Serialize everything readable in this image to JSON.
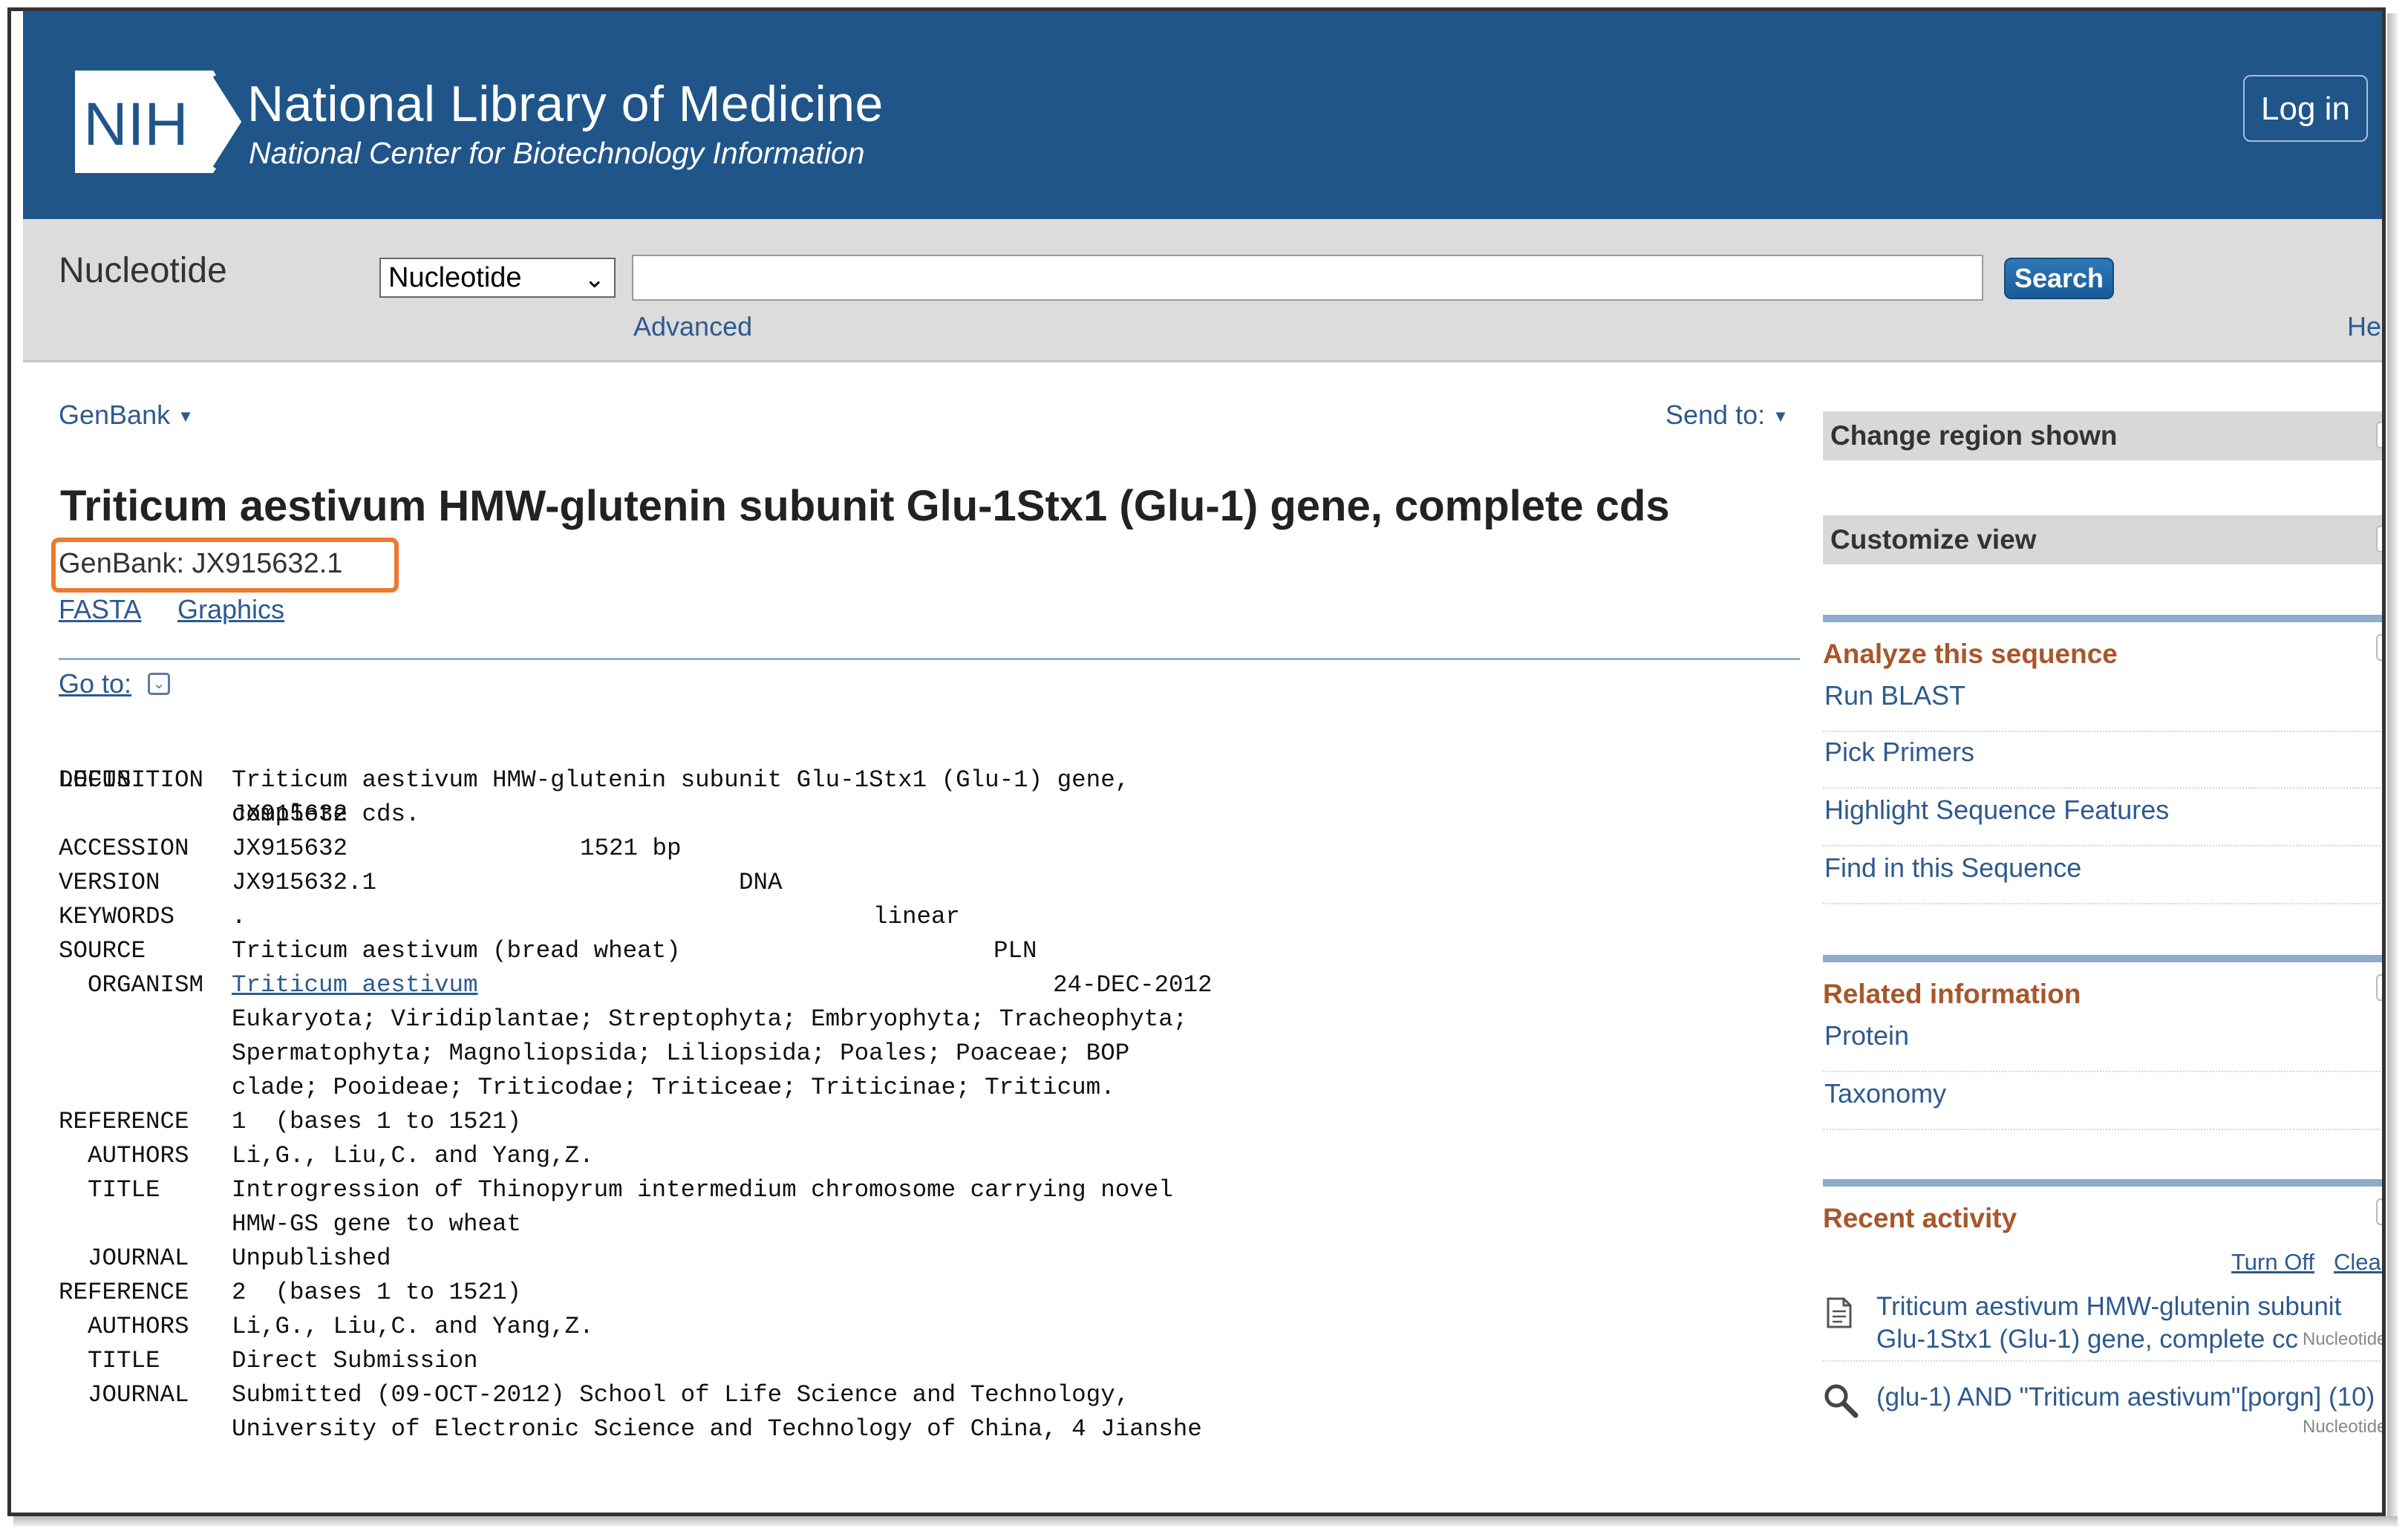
{
  "header": {
    "logo_text": "NIH",
    "title": "National Library of Medicine",
    "subtitle": "National Center for Biotechnology Information",
    "login_label": "Log in"
  },
  "search": {
    "db_label": "Nucleotide",
    "db_selected": "Nucleotide",
    "query": "",
    "button_label": "Search",
    "advanced_label": "Advanced",
    "help_label": "Help"
  },
  "record": {
    "format_label": "GenBank",
    "send_to_label": "Send to:",
    "title": "Triticum aestivum HMW-glutenin subunit Glu-1Stx1 (Glu-1) gene, complete cds",
    "accession_line": "GenBank: JX915632.1",
    "links": [
      "FASTA",
      "Graphics"
    ],
    "goto_label": "Go to:"
  },
  "flatfile": {
    "locus": {
      "key": "LOCUS",
      "name": "JX915632",
      "length": "1521 bp",
      "moltype": "DNA",
      "topology": "linear",
      "division": "PLN",
      "date": "24-DEC-2012"
    },
    "rows": [
      {
        "key": "DEFINITION",
        "val": "Triticum aestivum HMW-glutenin subunit Glu-1Stx1 (Glu-1) gene,"
      },
      {
        "key": "",
        "val": "complete cds."
      },
      {
        "key": "ACCESSION",
        "val": "JX915632"
      },
      {
        "key": "VERSION",
        "val": "JX915632.1"
      },
      {
        "key": "KEYWORDS",
        "val": "."
      },
      {
        "key": "SOURCE",
        "val": "Triticum aestivum (bread wheat)"
      },
      {
        "key": "  ORGANISM",
        "val": "Triticum aestivum",
        "link": true
      },
      {
        "key": "",
        "val": "Eukaryota; Viridiplantae; Streptophyta; Embryophyta; Tracheophyta;"
      },
      {
        "key": "",
        "val": "Spermatophyta; Magnoliopsida; Liliopsida; Poales; Poaceae; BOP"
      },
      {
        "key": "",
        "val": "clade; Pooideae; Triticodae; Triticeae; Triticinae; Triticum."
      },
      {
        "key": "REFERENCE",
        "val": "1  (bases 1 to 1521)"
      },
      {
        "key": "  AUTHORS",
        "val": "Li,G., Liu,C. and Yang,Z."
      },
      {
        "key": "  TITLE",
        "val": "Introgression of Thinopyrum intermedium chromosome carrying novel"
      },
      {
        "key": "",
        "val": "HMW-GS gene to wheat"
      },
      {
        "key": "  JOURNAL",
        "val": "Unpublished"
      },
      {
        "key": "REFERENCE",
        "val": "2  (bases 1 to 1521)"
      },
      {
        "key": "  AUTHORS",
        "val": "Li,G., Liu,C. and Yang,Z."
      },
      {
        "key": "  TITLE",
        "val": "Direct Submission"
      },
      {
        "key": "  JOURNAL",
        "val": "Submitted (09-OCT-2012) School of Life Science and Technology,"
      },
      {
        "key": "",
        "val": "University of Electronic Science and Technology of China, 4 Jianshe"
      }
    ]
  },
  "sidebar": {
    "change_region": "Change region shown",
    "customize_view": "Customize view",
    "analyze": {
      "title": "Analyze this sequence",
      "items": [
        "Run BLAST",
        "Pick Primers",
        "Highlight Sequence Features",
        "Find in this Sequence"
      ]
    },
    "related": {
      "title": "Related information",
      "items": [
        "Protein",
        "Taxonomy"
      ]
    },
    "recent": {
      "title": "Recent activity",
      "turn_off": "Turn Off",
      "clear": "Clear",
      "items": [
        {
          "line1": "Triticum aestivum HMW-glutenin subunit",
          "line2": "Glu-1Stx1 (Glu-1) gene, complete cc",
          "db": "Nucleotide",
          "icon": "document-icon"
        },
        {
          "line1": "(glu-1) AND \"Triticum aestivum\"[porgn] (10)",
          "line2": "",
          "db": "Nucleotide",
          "icon": "search-icon"
        }
      ]
    }
  },
  "colors": {
    "header_bg": "#20558a",
    "link": "#2d5a8e",
    "highlight_box": "#ed7a2e",
    "portlet_title": "#a8562a"
  }
}
